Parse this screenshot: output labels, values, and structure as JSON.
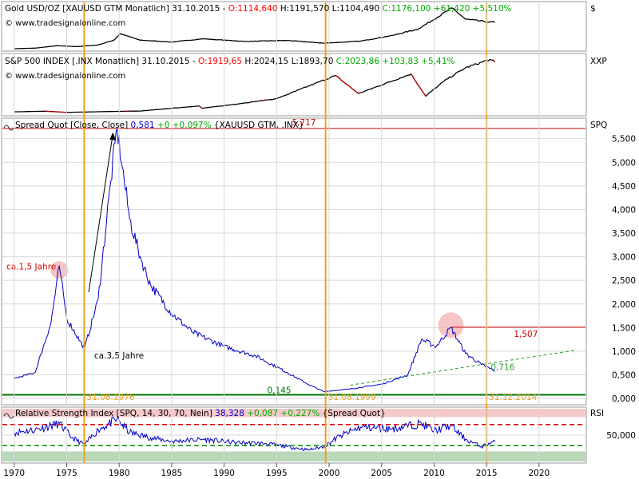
{
  "colors": {
    "background": "#ffffff",
    "panel_border": "#9a9a9a",
    "grid": "#d8d8d8",
    "price_line": "#000000",
    "sp_down": "#cc0000",
    "spread_line": "#0000cc",
    "rsi_line": "#0000cc",
    "open_red": "#ff0000",
    "up_green": "#00aa00",
    "marker_orange": "#f0a020",
    "level_red": "#d00000",
    "base_green": "#007700",
    "trend_green": "#2e9a2e",
    "rsi_upper": "#e00000",
    "rsi_lower": "#008800",
    "rsi_high_band": "#f6c9c9",
    "rsi_low_band": "#b8d8b8",
    "highlight_circle": "#f2b0b0",
    "vol_text": "#0000cc"
  },
  "panels": {
    "gold": {
      "title": "Gold USD/OZ [XAUUSD GTM  Monatlich] 31.10.2015 - ",
      "open": "O:1114,640",
      "hl": " H:1191,570 L:1104,490 ",
      "close": "C:1176,100 +61,420 +5,510%",
      "source": "© www.tradesignalonline.com",
      "axis_label": "$"
    },
    "sp500": {
      "title": "S&P 500 INDEX [.INX  Monatlich] 31.10.2015 - ",
      "open": "O:1919,65",
      "hl": " H:2024,15 L:1893,70 ",
      "close": "C:2023,86 +103,83 +5,41%",
      "source": "© www.tradesignalonline.com",
      "axis_label": "XXP"
    },
    "spread": {
      "title": "Spread Quot [Close, Close] ",
      "value": "0,581",
      "change": " +0 +0,097%",
      "suffix": " {XAUUSD GTM, .INX}",
      "axis_label": "SPQ"
    },
    "rsi": {
      "title": "Relative Strength Index [SPQ, 14, 30, 70, Nein] ",
      "value": "38,328",
      "change": " +0,087 +0,227%",
      "suffix": " {Spread Quot}",
      "axis_label": "RSI"
    }
  },
  "chart_data": [
    {
      "type": "line",
      "name": "gold-price",
      "x": [
        1970,
        1972,
        1974,
        1976,
        1978,
        1979.5,
        1980.1,
        1982,
        1985,
        1988,
        1992,
        1996,
        1999.5,
        2003,
        2006,
        2008.5,
        2011.7,
        2013,
        2015.1,
        2015.8
      ],
      "y": [
        35,
        58,
        160,
        125,
        195,
        400,
        680,
        400,
        320,
        460,
        345,
        390,
        270,
        360,
        600,
        880,
        1780,
        1300,
        1180,
        1176
      ],
      "ylim": [
        0,
        1850
      ]
    },
    {
      "type": "line",
      "name": "sp500-index",
      "x": [
        1970,
        1973,
        1975,
        1980,
        1982,
        1987.6,
        1987.9,
        1990,
        1995,
        2000.6,
        2002.8,
        2007.8,
        2009.2,
        2011,
        2013,
        2015.3,
        2015.8
      ],
      "y": [
        90,
        115,
        70,
        110,
        120,
        320,
        230,
        330,
        600,
        1500,
        800,
        1560,
        700,
        1300,
        1800,
        2120,
        2024
      ],
      "ylim": [
        0,
        2200
      ]
    },
    {
      "type": "line",
      "name": "spread-quot",
      "yticks": [
        0,
        0.5,
        1,
        1.5,
        2,
        2.5,
        3,
        3.5,
        4,
        4.5,
        5,
        5.5
      ],
      "ytick_labels": [
        "0,000",
        "0,500",
        "1,000",
        "1,500",
        "2,000",
        "2,500",
        "3,000",
        "3,500",
        "4,000",
        "4,500",
        "5,000",
        "5,500"
      ],
      "ylim": [
        -0.1,
        5.9
      ],
      "x": [
        1970,
        1972,
        1973.5,
        1974.3,
        1975,
        1976.7,
        1978,
        1979.2,
        1979.8,
        1980.3,
        1981,
        1982,
        1983,
        1985,
        1987,
        1990,
        1993,
        1996,
        1998,
        1999.5,
        2002,
        2005,
        2007.5,
        2008.8,
        2010.2,
        2011.6,
        2013,
        2014.5,
        2015.8
      ],
      "y": [
        0.42,
        0.55,
        1.6,
        2.8,
        1.7,
        1.05,
        2.1,
        4.6,
        5.717,
        4.9,
        3.8,
        3.0,
        2.4,
        1.8,
        1.4,
        1.1,
        0.9,
        0.55,
        0.3,
        0.145,
        0.2,
        0.3,
        0.5,
        1.25,
        1.1,
        1.5,
        0.95,
        0.72,
        0.581
      ],
      "levels": [
        {
          "label": "5,717",
          "value": 5.717
        },
        {
          "label": "1,507",
          "value": 1.507
        },
        {
          "label": "0,145",
          "value": 0.145
        }
      ],
      "trend_label": "0,716",
      "trend": {
        "x": [
          2002,
          2014.5,
          2023.5
        ],
        "y": [
          0.28,
          0.716,
          1.02
        ]
      },
      "annotations": [
        {
          "text": "ca.1,5 Jahre",
          "x": 1974.3,
          "y": 2.8
        },
        {
          "text": "ca.3,5 Jahre",
          "x": 1976.7,
          "y": 1.05
        }
      ],
      "markers": [
        {
          "label": "31.08.1976",
          "x": 1976.67
        },
        {
          "label": "31.08.1999",
          "x": 1999.67
        },
        {
          "label": "31.12.2014",
          "x": 2015.0
        }
      ]
    },
    {
      "type": "line",
      "name": "relative-strength-index",
      "ytick_labels": [
        "50,000"
      ],
      "ylim": [
        0,
        100
      ],
      "upper": 70,
      "lower": 30,
      "x": [
        1970,
        1972,
        1974.3,
        1975.5,
        1976.7,
        1978,
        1979.8,
        1981,
        1983,
        1985,
        1988,
        1991,
        1994,
        1996,
        1998,
        1999.5,
        2001,
        2003,
        2006,
        2008.8,
        2010,
        2011.6,
        2013,
        2014.5,
        2015.8
      ],
      "y": [
        55,
        60,
        72,
        45,
        32,
        60,
        80,
        55,
        45,
        38,
        42,
        36,
        34,
        28,
        22,
        28,
        48,
        65,
        62,
        72,
        58,
        68,
        42,
        28,
        38
      ]
    }
  ],
  "x_axis": {
    "xlim": [
      1968.8,
      2024.5
    ],
    "ticks": [
      1970,
      1975,
      1980,
      1985,
      1990,
      1995,
      2000,
      2005,
      2010,
      2015,
      2020
    ],
    "tick_labels": [
      "1970",
      "1975",
      "1980",
      "1985",
      "1990",
      "1995",
      "2000",
      "2005",
      "2010",
      "2015",
      "2020"
    ]
  }
}
